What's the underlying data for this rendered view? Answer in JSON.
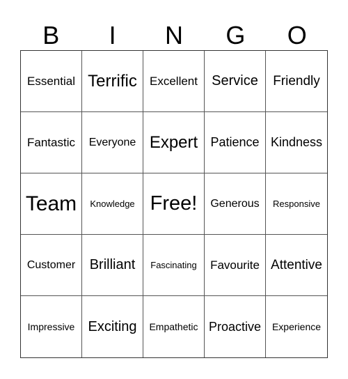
{
  "header": {
    "letters": [
      "B",
      "I",
      "N",
      "G",
      "O"
    ]
  },
  "cells": [
    "Essential",
    "Terrific",
    "Excellent",
    "Service",
    "Friendly",
    "Fantastic",
    "Everyone",
    "Expert",
    "Patience",
    "Kindness",
    "Team",
    "Knowledge",
    "Free!",
    "Generous",
    "Responsive",
    "Customer",
    "Brilliant",
    "Fascinating",
    "Favourite",
    "Attentive",
    "Impressive",
    "Exciting",
    "Empathetic",
    "Proactive",
    "Experience"
  ]
}
